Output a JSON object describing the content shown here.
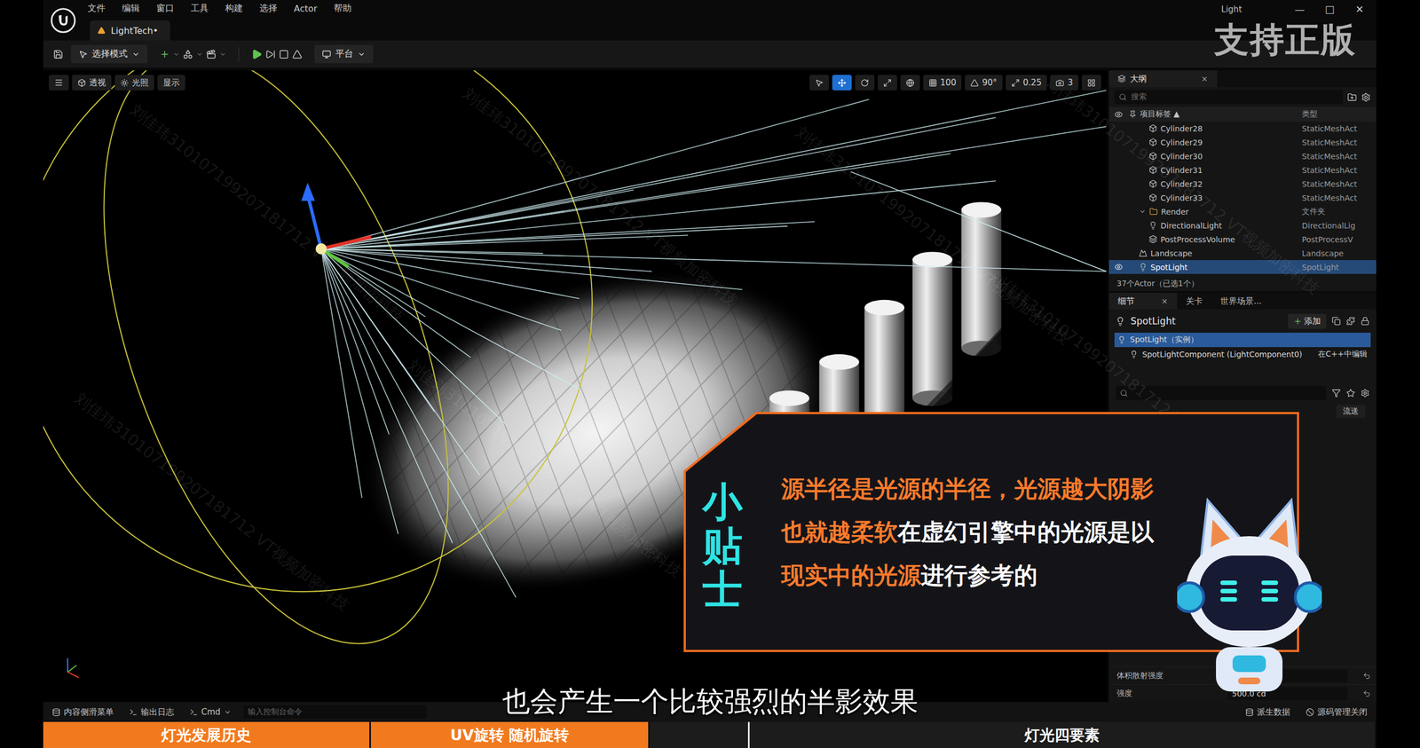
{
  "window": {
    "title": "Light",
    "controls": [
      "—",
      "□",
      "✕"
    ]
  },
  "menu": [
    "文件",
    "编辑",
    "窗口",
    "工具",
    "构建",
    "选择",
    "Actor",
    "帮助"
  ],
  "document_tab": {
    "label": "LightTech•"
  },
  "toolbar": {
    "mode": "选择模式",
    "platform": "平台"
  },
  "brand_watermark": "支持正版",
  "watermark": "刘佳玮310107199207181712 VT视频加密科技",
  "viewport": {
    "buttons": [
      "透视",
      "光照",
      "显示"
    ],
    "snap": [
      "100",
      "90°",
      "0.25",
      "3"
    ]
  },
  "outliner": {
    "title": "大纲",
    "search_placeholder": "搜索",
    "columns": [
      {
        "label": "项目标签",
        "sort": "▲"
      },
      {
        "label": "类型"
      }
    ],
    "rows": [
      {
        "name": "Cylinder28",
        "type": "StaticMeshAct",
        "kind": "mesh",
        "depth": 3,
        "selected": false
      },
      {
        "name": "Cylinder29",
        "type": "StaticMeshAct",
        "kind": "mesh",
        "depth": 3,
        "selected": false
      },
      {
        "name": "Cylinder30",
        "type": "StaticMeshAct",
        "kind": "mesh",
        "depth": 3,
        "selected": false
      },
      {
        "name": "Cylinder31",
        "type": "StaticMeshAct",
        "kind": "mesh",
        "depth": 3,
        "selected": false
      },
      {
        "name": "Cylinder32",
        "type": "StaticMeshAct",
        "kind": "mesh",
        "depth": 3,
        "selected": false
      },
      {
        "name": "Cylinder33",
        "type": "StaticMeshAct",
        "kind": "mesh",
        "depth": 3,
        "selected": false
      },
      {
        "name": "Render",
        "type": "文件夹",
        "kind": "folder",
        "depth": 2,
        "expanded": true,
        "selected": false
      },
      {
        "name": "DirectionalLight",
        "type": "DirectionalLig",
        "kind": "light",
        "depth": 3,
        "selected": false
      },
      {
        "name": "PostProcessVolume",
        "type": "PostProcessV",
        "kind": "volume",
        "depth": 3,
        "selected": false
      },
      {
        "name": "Landscape",
        "type": "Landscape",
        "kind": "landscape",
        "depth": 2,
        "selected": false
      },
      {
        "name": "SpotLight",
        "type": "SpotLight",
        "kind": "light",
        "depth": 2,
        "selected": true
      }
    ],
    "footer": "37个Actor（已选1个）"
  },
  "details": {
    "tabs": [
      {
        "label": "细节",
        "selected": true,
        "closable": true
      },
      {
        "label": "关卡",
        "selected": false,
        "closable": false
      },
      {
        "label": "世界场景...",
        "selected": false,
        "closable": false
      }
    ],
    "actor": "SpotLight",
    "add_button": "添加",
    "components": [
      {
        "label": "SpotLight（实例）",
        "selected": true
      },
      {
        "label": "SpotLightComponent (LightComponent0)",
        "note": "在C++中编辑",
        "selected": false
      }
    ],
    "categories": [
      "流送"
    ],
    "properties": [
      {
        "label": "体积散射强度"
      },
      {
        "label": "强度",
        "value": "500.0 cd"
      }
    ]
  },
  "status_bar": {
    "left": [
      "内容侧滑菜单",
      "输出日志",
      "Cmd"
    ],
    "console_placeholder": "输入控制台命令",
    "right": [
      "派生数据",
      "源码管理关闭"
    ]
  },
  "chapters": [
    {
      "label": "灯光发展历史",
      "done": true
    },
    {
      "label": "UV旋转 随机旋转",
      "done": true
    },
    {
      "label": "灯光四要素",
      "done": false
    }
  ],
  "tip": {
    "title": "小贴士",
    "lines": [
      [
        {
          "text": "源半径是光源的半径，光源越大阴影",
          "highlight": true
        }
      ],
      [
        {
          "text": "也就越柔软",
          "highlight": true
        },
        {
          "text": "在虚幻引擎中的光源是以",
          "highlight": false
        }
      ],
      [
        {
          "text": "现实中的光源",
          "highlight": true
        },
        {
          "text": "进行参考的",
          "highlight": false
        }
      ]
    ]
  },
  "subtitle": "也会产生一个比较强烈的半影效果"
}
